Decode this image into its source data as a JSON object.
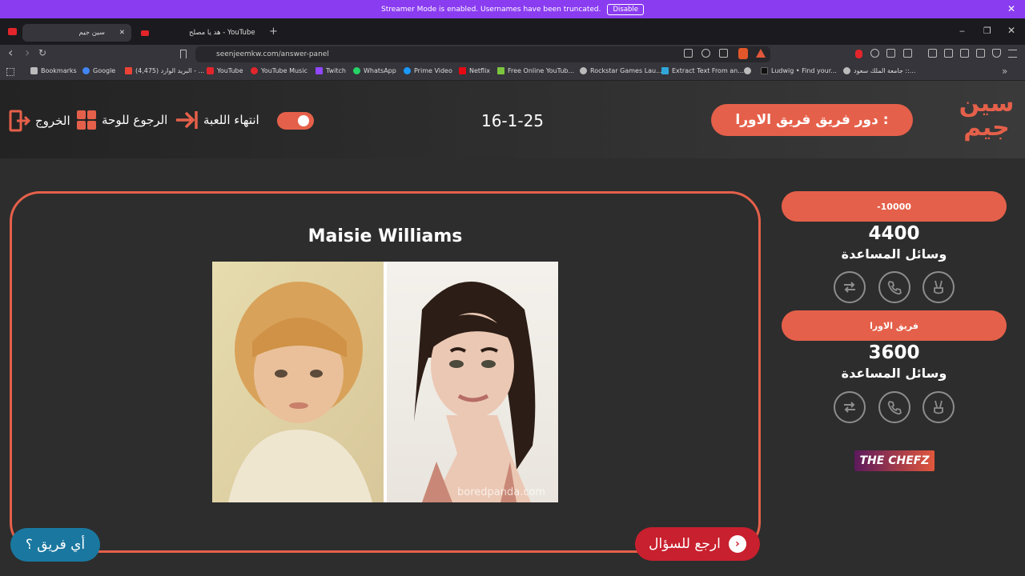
{
  "banner": {
    "text": "Streamer Mode is enabled. Usernames have been truncated.",
    "disable": "Disable",
    "close": "✕"
  },
  "tabs": [
    {
      "label": "سين جيم",
      "close": "✕"
    },
    {
      "label": "هد يا مصلح - YouTube"
    }
  ],
  "newtab": "+",
  "window": {
    "min": "‒",
    "restore": "❐",
    "close": "✕"
  },
  "nav": {
    "back": "‹",
    "forward": "›",
    "reload": "↻"
  },
  "address": {
    "url": "seenjeemkw.com/answer-panel"
  },
  "bookmarks": [
    {
      "label": "Bookmarks",
      "color": "#bbbbbb"
    },
    {
      "label": "Google",
      "color": "#4285f4"
    },
    {
      "label": "(4,475) البريد الوارد - ...",
      "color": "#ea4335"
    },
    {
      "label": "YouTube",
      "color": "#e3252b"
    },
    {
      "label": "YouTube Music",
      "color": "#e3252b"
    },
    {
      "label": "Twitch",
      "color": "#9146ff"
    },
    {
      "label": "WhatsApp",
      "color": "#25d366"
    },
    {
      "label": "Prime Video",
      "color": "#1a98ff"
    },
    {
      "label": "Netflix",
      "color": "#e50914"
    },
    {
      "label": "Free Online YouTub...",
      "color": "#7cc53e"
    },
    {
      "label": "Rockstar Games Lau...",
      "color": "#bbbbbb"
    },
    {
      "label": "Extract Text From an...",
      "color": "#30a7d8"
    },
    {
      "label": "",
      "color": "#bbbbbb"
    },
    {
      "label": "Ludwig • Find your...",
      "color": "#222222"
    },
    {
      "label": "جامعة الملك سعود ::...",
      "color": "#bbbbbb"
    }
  ],
  "header": {
    "exit": "الخروج",
    "back_board": "الرجوع للوحة",
    "end_game": "انتهاء اللعبة",
    "date": "16-1-25",
    "turn_prefix": "دور فريق :",
    "turn_team": "فريق الاورا",
    "logo": "سين جيم"
  },
  "answer": {
    "name": "Maisie Williams",
    "watermark": "boredpanda.com"
  },
  "buttons": {
    "back_question": "ارجع للسؤال",
    "which_team": "أي فريق ؟"
  },
  "teams": [
    {
      "name": "-10000",
      "score": "4400",
      "aids_label": "وسائل المساعدة"
    },
    {
      "name": "فريق الاورا",
      "score": "3600",
      "aids_label": "وسائل المساعدة"
    }
  ],
  "sponsor": "THE CHEFZ",
  "colors": {
    "accent": "#e5604a",
    "back_btn": "#c8202e",
    "which_btn": "#1a78a0",
    "banner": "#8a3cf0"
  }
}
